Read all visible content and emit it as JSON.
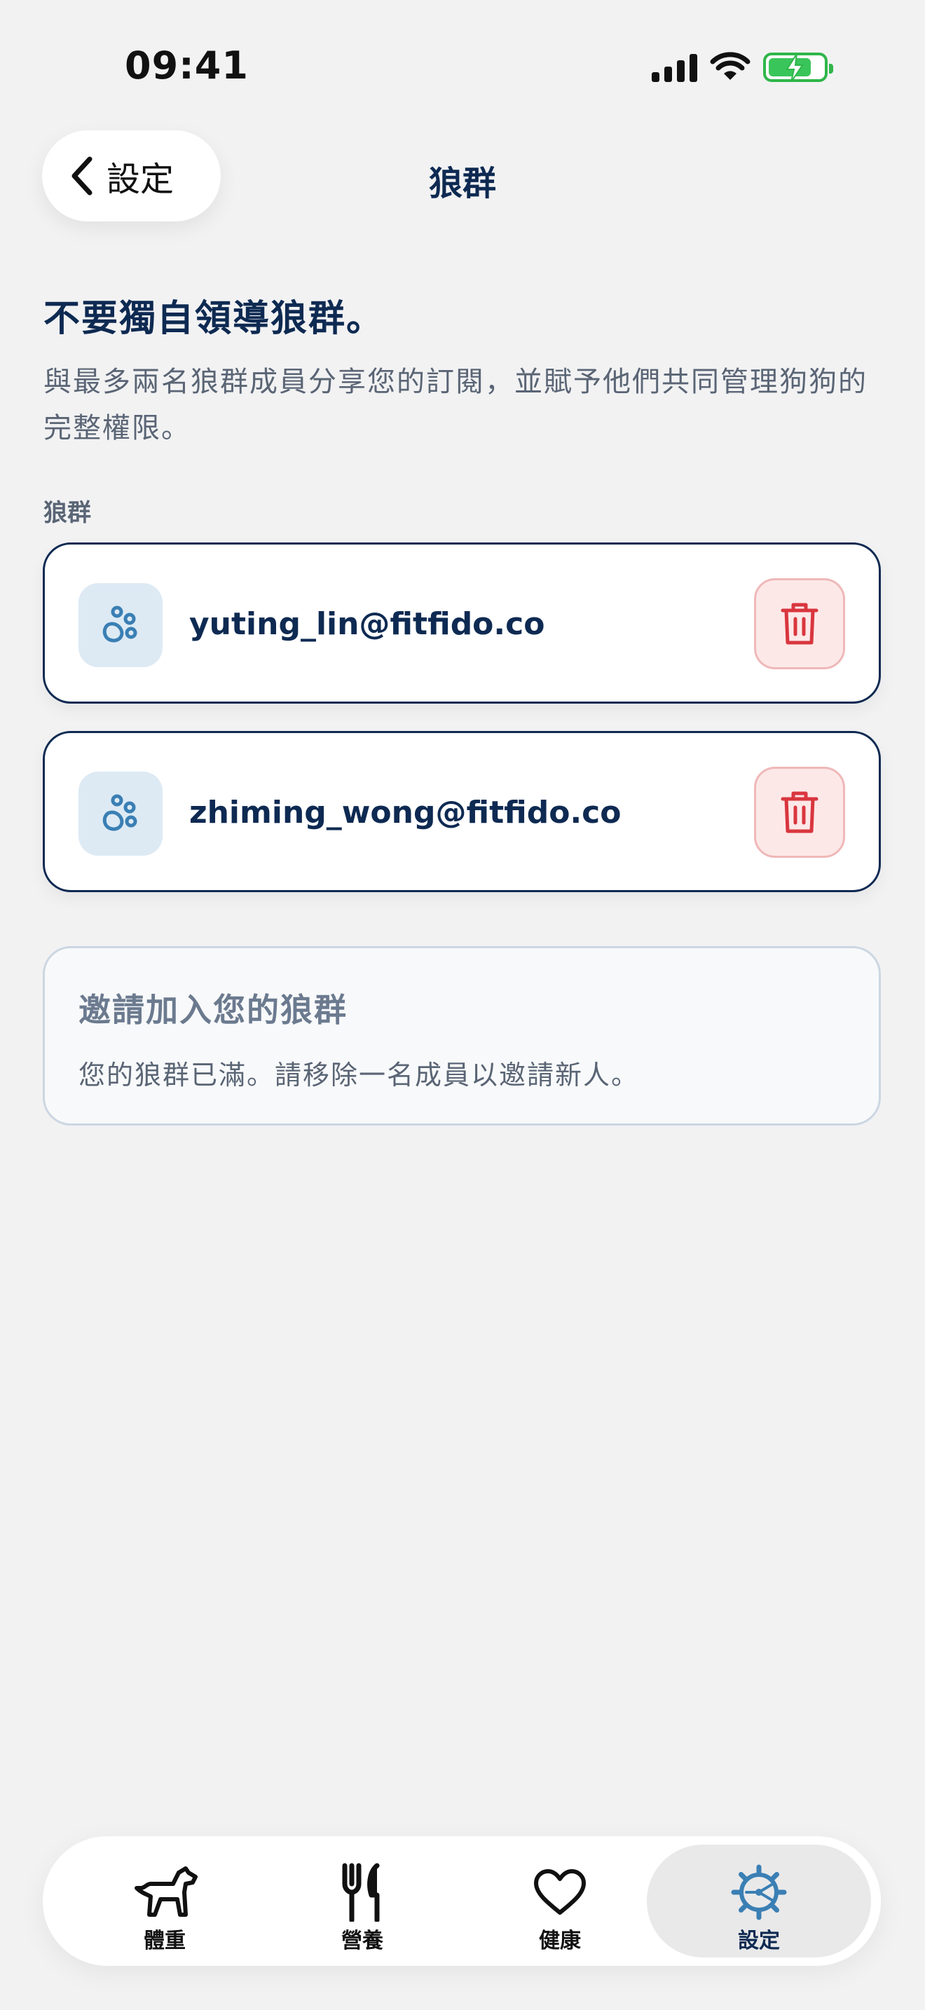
{
  "status_bar": {
    "time": "09:41"
  },
  "nav": {
    "back_label": "設定",
    "title": "狼群"
  },
  "intro": {
    "headline": "不要獨自領導狼群。",
    "description": "與最多兩名狼群成員分享您的訂閱，並賦予他們共同管理狗狗的完整權限。"
  },
  "pack": {
    "section_label": "狼群",
    "members": [
      {
        "email": "yuting_lin@fitfido.co"
      },
      {
        "email": "zhiming_wong@fitfido.co"
      }
    ]
  },
  "invite": {
    "title": "邀請加入您的狼群",
    "message": "您的狼群已滿。請移除一名成員以邀請新人。"
  },
  "tab_bar": {
    "tabs": [
      {
        "label": "體重",
        "icon": "dog-icon"
      },
      {
        "label": "營養",
        "icon": "fork-knife-icon"
      },
      {
        "label": "健康",
        "icon": "heart-icon"
      },
      {
        "label": "設定",
        "icon": "gear-icon"
      }
    ],
    "active": "設定"
  },
  "colors": {
    "navy": "#0e2a52",
    "accent_blue": "#3a7fb4",
    "delete_red": "#d9363e",
    "battery_green": "#39c55a"
  }
}
